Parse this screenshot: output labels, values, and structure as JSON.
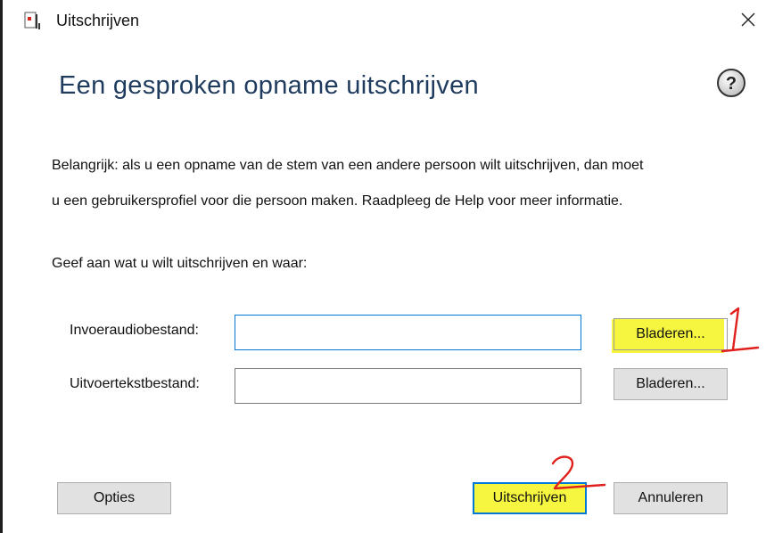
{
  "window": {
    "title": "Uitschrijven"
  },
  "heading": "Een gesproken opname uitschrijven",
  "body": {
    "line1": "Belangrijk: als u een opname van de stem van een andere persoon wilt uitschrijven, dan moet",
    "line2": "u een gebruikersprofiel voor die persoon maken. Raadpleeg de Help voor meer informatie.",
    "instruction": "Geef aan wat u wilt uitschrijven en waar:"
  },
  "fields": {
    "input_audio": {
      "label": "Invoeraudiobestand:",
      "value": "",
      "browse_label": "Bladeren..."
    },
    "output_text": {
      "label": "Uitvoertekstbestand:",
      "value": "",
      "browse_label": "Bladeren..."
    }
  },
  "buttons": {
    "options": "Opties",
    "transcribe": "Uitschrijven",
    "cancel": "Annuleren"
  },
  "annotations": {
    "marker_1": "1",
    "marker_2": "2",
    "highlight_color": "#f4f41e",
    "marker_color": "#e0201c"
  },
  "icons": {
    "app": "speech-recording-icon",
    "close": "close-icon",
    "help": "help-icon"
  }
}
